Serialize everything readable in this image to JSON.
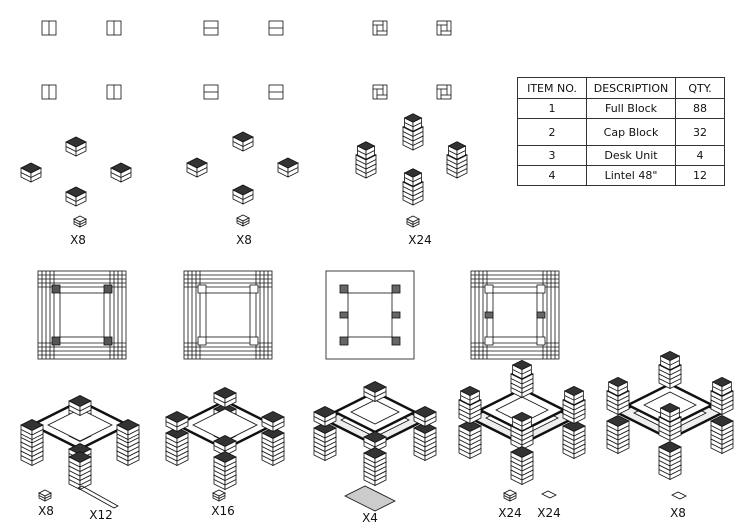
{
  "bom_table": {
    "headers": [
      "ITEM NO.",
      "DESCRIPTION",
      "QTY."
    ],
    "rows": [
      {
        "item": "1",
        "description": "Full Block",
        "qty": "88"
      },
      {
        "item": "2",
        "description": "Cap Block",
        "qty": "32"
      },
      {
        "item": "3",
        "description": "Desk Unit",
        "qty": "4"
      },
      {
        "item": "4",
        "description": "Lintel 48\"",
        "qty": "12"
      }
    ]
  },
  "step_labels": {
    "step1_blocks": "X8",
    "step2_blocks": "X8",
    "step3_caps": "X24",
    "step4_blocks": "X8",
    "step4_lintels": "X12",
    "step5_blocks": "X16",
    "step6_desk": "X4",
    "step7_blocks": "X24",
    "step7_caps": "X24",
    "step8_caps": "X8"
  },
  "colors": {
    "line": "#111111",
    "background": "#ffffff"
  }
}
